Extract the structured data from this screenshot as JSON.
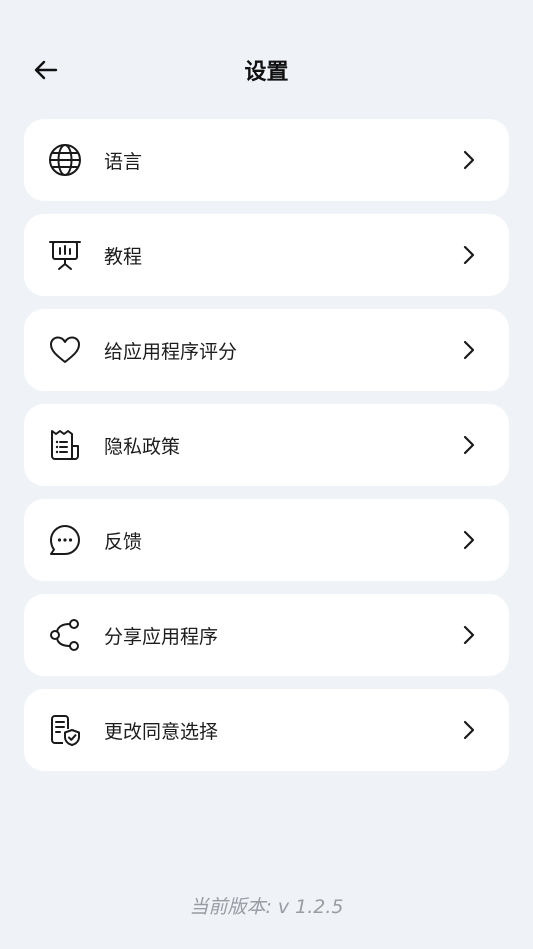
{
  "header": {
    "title": "设置",
    "back_icon": "arrow-left-icon"
  },
  "items": [
    {
      "id": "language",
      "label": "语言",
      "icon": "globe-icon"
    },
    {
      "id": "tutorial",
      "label": "教程",
      "icon": "presentation-board-icon"
    },
    {
      "id": "rate",
      "label": "给应用程序评分",
      "icon": "heart-icon"
    },
    {
      "id": "privacy",
      "label": "隐私政策",
      "icon": "document-receipt-icon"
    },
    {
      "id": "feedback",
      "label": "反馈",
      "icon": "chat-bubble-icon"
    },
    {
      "id": "share",
      "label": "分享应用程序",
      "icon": "share-icon"
    },
    {
      "id": "consent",
      "label": "更改同意选择",
      "icon": "document-shield-icon"
    }
  ],
  "footer": {
    "version": "当前版本: v 1.2.5"
  },
  "colors": {
    "background": "#eff3f8",
    "card": "#ffffff",
    "text": "#1d1d1d",
    "muted": "#9a9ba3"
  }
}
